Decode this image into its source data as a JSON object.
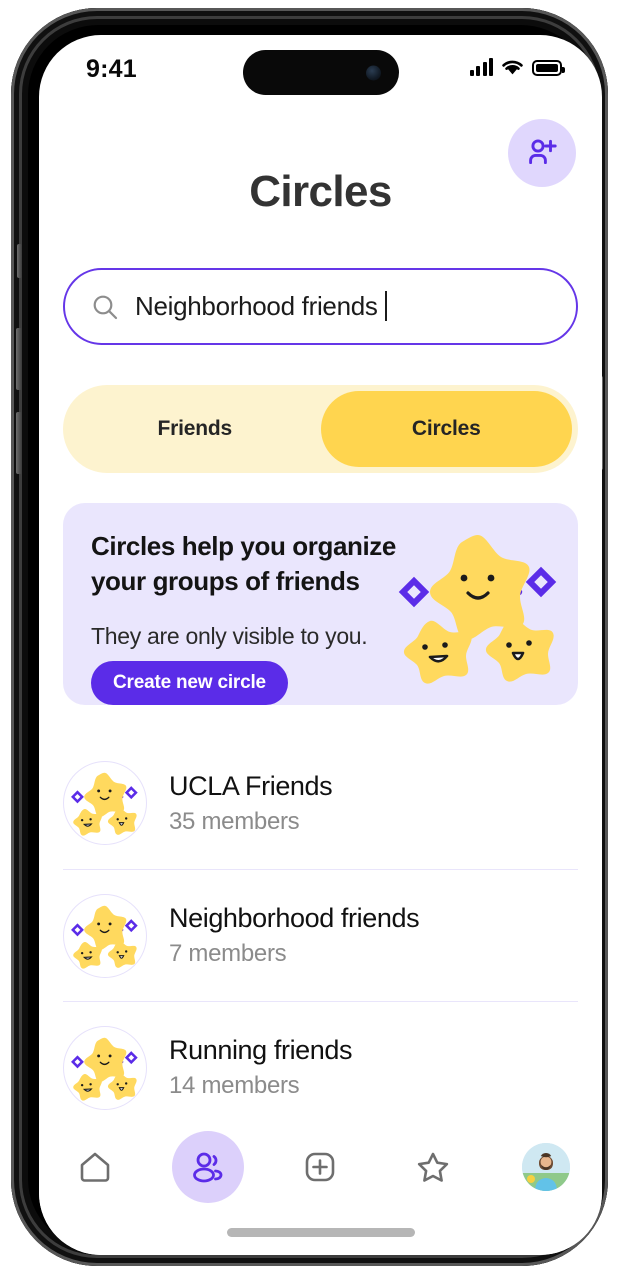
{
  "status_bar": {
    "time": "9:41",
    "signal_icon": "signal-bars-icon",
    "wifi_icon": "wifi-icon",
    "battery_icon": "battery-full-icon"
  },
  "header": {
    "title": "Circles",
    "add_person_icon": "add-person-icon"
  },
  "search": {
    "value": "Neighborhood friends",
    "placeholder": "Search",
    "icon": "search-icon"
  },
  "segmented": {
    "options": [
      {
        "label": "Friends",
        "active": false
      },
      {
        "label": "Circles",
        "active": true
      }
    ]
  },
  "promo_card": {
    "heading": "Circles help you organize your groups of friends",
    "subtext": "They are only visible to you.",
    "cta_label": "Create new circle",
    "art": "three-stars-illustration"
  },
  "circles": [
    {
      "name": "UCLA Friends",
      "members": "35 members",
      "avatar": "stars-avatar"
    },
    {
      "name": "Neighborhood friends",
      "members": "7 members",
      "avatar": "stars-avatar"
    },
    {
      "name": "Running friends",
      "members": "14 members",
      "avatar": "stars-avatar"
    }
  ],
  "tab_bar": {
    "tabs": [
      {
        "name": "home",
        "icon": "home-icon",
        "active": false
      },
      {
        "name": "circles",
        "icon": "people-icon",
        "active": true
      },
      {
        "name": "create",
        "icon": "plus-square-icon",
        "active": false
      },
      {
        "name": "favorites",
        "icon": "star-icon",
        "active": false
      },
      {
        "name": "profile",
        "icon": "profile-avatar-icon",
        "active": false
      }
    ]
  },
  "colors": {
    "accent_purple": "#5b2ce8",
    "light_purple": "#e0d7fd",
    "promo_bg": "#eae6fd",
    "yellow_track": "#fdf3cf",
    "yellow_active": "#ffd54f",
    "star_yellow": "#ffd95e",
    "text_dark": "#111111",
    "text_muted": "#8b8b8b"
  }
}
